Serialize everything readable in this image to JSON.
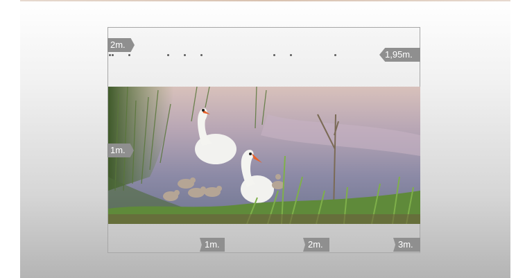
{
  "measure": {
    "top_left_label": "2m.",
    "top_right_label": "1,95m.",
    "left_mid_label": "1m.",
    "bottom_labels": [
      "1m.",
      "2m.",
      "3m."
    ]
  },
  "photo": {
    "description_icon": "swan-lake-photo"
  },
  "colors": {
    "tag": "#8f8f8f",
    "frame_border": "#a7a7a7"
  }
}
